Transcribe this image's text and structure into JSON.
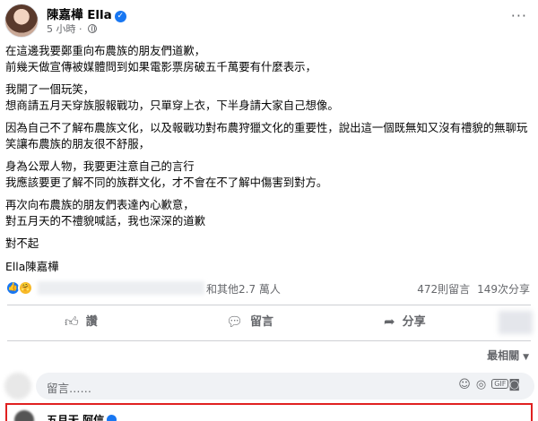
{
  "post": {
    "author": "陳嘉樺 Ella",
    "timestamp": "5 小時",
    "more_label": "···",
    "paragraphs": [
      [
        "在這邊我要鄭重向布農族的朋友們道歉，",
        "前幾天做宣傳被媒體問到如果電影票房破五千萬要有什麼表示，"
      ],
      [
        "我開了一個玩笑，",
        "想商請五月天穿族服報戰功，只單穿上衣，下半身請大家自己想像。"
      ],
      [
        "因為自己不了解布農族文化，以及報戰功對布農狩獵文化的重要性，說出這一個既無知又沒有禮貌的無聊玩笑讓布農族的朋友很不舒服，"
      ],
      [
        "身為公眾人物，我要更注意自己的言行",
        "我應該要更了解不同的族群文化，才不會在不了解中傷害到對方。"
      ],
      [
        "再次向布農族的朋友們表達內心歉意，",
        "對五月天的不禮貌喊話，我也深深的道歉"
      ],
      [
        "對不起"
      ],
      [
        "Ella陳嘉樺"
      ]
    ]
  },
  "reactions": {
    "summary": "和其他2.7 萬人",
    "comments": "472則留言",
    "shares": "149次分享"
  },
  "actions": {
    "like": "讚",
    "comment": "留言",
    "share": "分享"
  },
  "sort": {
    "label": "最相關"
  },
  "comment_input": {
    "placeholder": "留言……"
  },
  "comment_preview": {
    "name": "五月天 阿信"
  },
  "colors": {
    "accent": "#1877f2",
    "highlight_border": "#e02020"
  }
}
